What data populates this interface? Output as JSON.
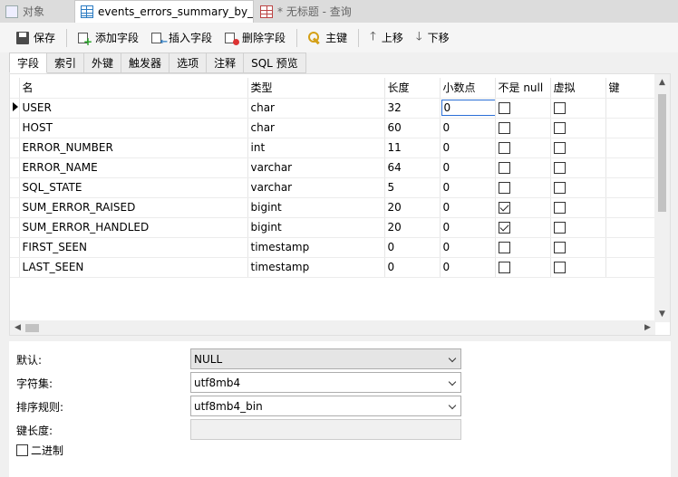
{
  "doc_tabs": [
    {
      "label": "对象",
      "icon": "doc-icon"
    },
    {
      "label": "events_errors_summary_by_...",
      "icon": "table-icon"
    },
    {
      "label": "* 无标题 - 查询",
      "icon": "query-icon"
    }
  ],
  "toolbar": {
    "save": "保存",
    "add_field": "添加字段",
    "insert_field": "插入字段",
    "delete_field": "删除字段",
    "primary_key": "主键",
    "move_up": "上移",
    "move_down": "下移"
  },
  "prop_tabs": [
    "字段",
    "索引",
    "外键",
    "触发器",
    "选项",
    "注释",
    "SQL 预览"
  ],
  "grid": {
    "headers": [
      "名",
      "类型",
      "长度",
      "小数点",
      "不是 null",
      "虚拟",
      "键"
    ],
    "rows": [
      {
        "name": "USER",
        "type": "char",
        "length": "32",
        "decimals": "0",
        "not_null": false,
        "virtual": false
      },
      {
        "name": "HOST",
        "type": "char",
        "length": "60",
        "decimals": "0",
        "not_null": false,
        "virtual": false
      },
      {
        "name": "ERROR_NUMBER",
        "type": "int",
        "length": "11",
        "decimals": "0",
        "not_null": false,
        "virtual": false
      },
      {
        "name": "ERROR_NAME",
        "type": "varchar",
        "length": "64",
        "decimals": "0",
        "not_null": false,
        "virtual": false
      },
      {
        "name": "SQL_STATE",
        "type": "varchar",
        "length": "5",
        "decimals": "0",
        "not_null": false,
        "virtual": false
      },
      {
        "name": "SUM_ERROR_RAISED",
        "type": "bigint",
        "length": "20",
        "decimals": "0",
        "not_null": true,
        "virtual": false
      },
      {
        "name": "SUM_ERROR_HANDLED",
        "type": "bigint",
        "length": "20",
        "decimals": "0",
        "not_null": true,
        "virtual": false
      },
      {
        "name": "FIRST_SEEN",
        "type": "timestamp",
        "length": "0",
        "decimals": "0",
        "not_null": false,
        "virtual": false
      },
      {
        "name": "LAST_SEEN",
        "type": "timestamp",
        "length": "0",
        "decimals": "0",
        "not_null": false,
        "virtual": false
      }
    ],
    "selected_row": 0
  },
  "props": {
    "default_label": "默认:",
    "default_value": "NULL",
    "charset_label": "字符集:",
    "charset_value": "utf8mb4",
    "collation_label": "排序规则:",
    "collation_value": "utf8mb4_bin",
    "keylen_label": "键长度:",
    "keylen_value": "",
    "binary_label": "二进制",
    "binary_checked": false
  },
  "colors": {
    "selection_outline": "#2b6fd6",
    "active_tab_bg": "#ffffff",
    "window_bg": "#f0f0f0"
  }
}
